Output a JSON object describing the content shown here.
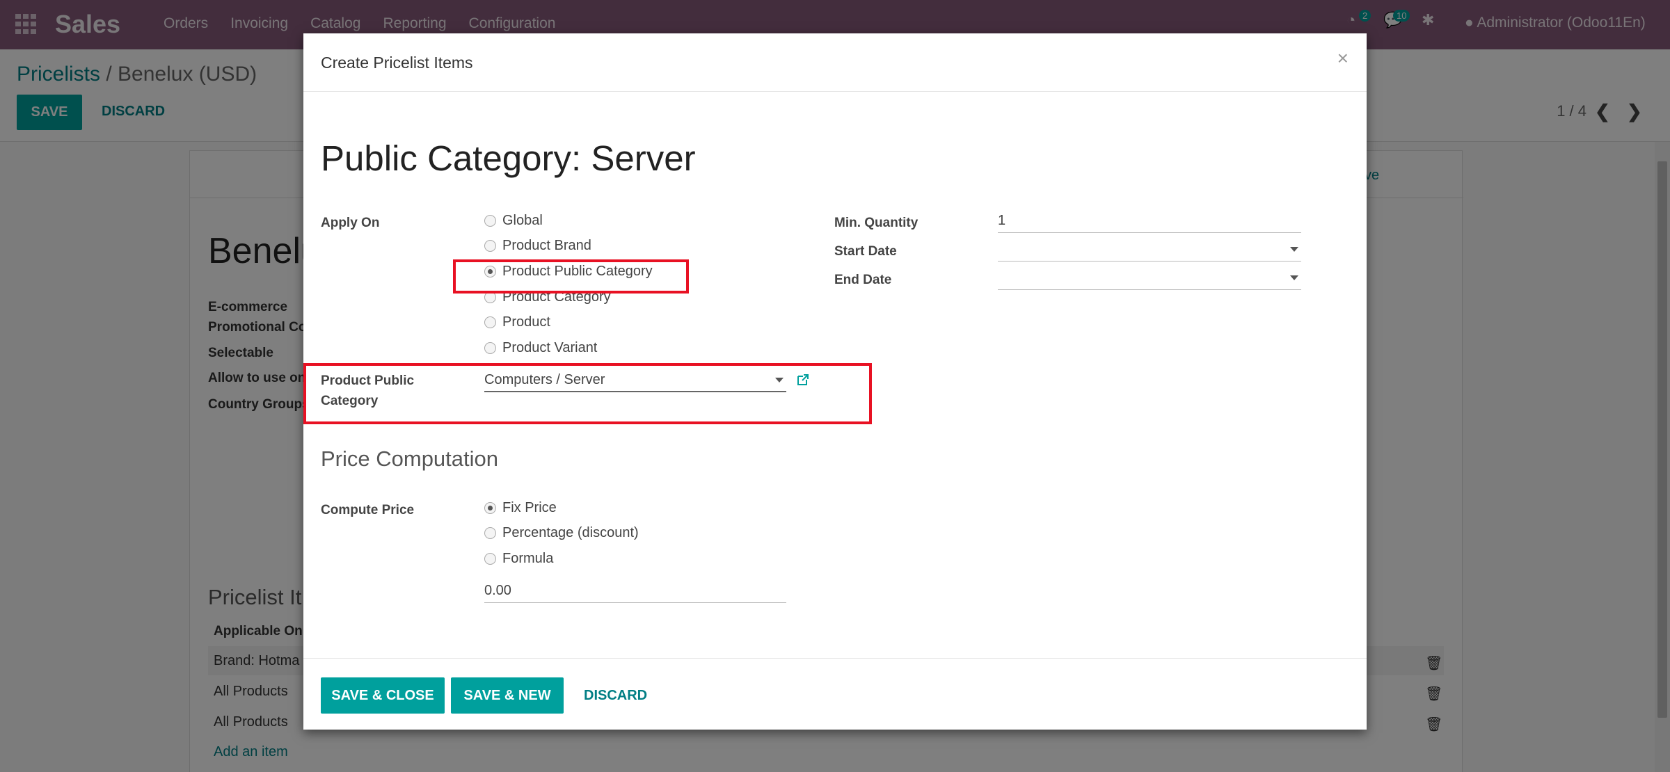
{
  "topbar": {
    "app_name": "Sales",
    "menu": [
      "Orders",
      "Invoicing",
      "Catalog",
      "Reporting",
      "Configuration"
    ],
    "activity_count": "2",
    "message_count": "10",
    "user": "Administrator (Odoo11En)"
  },
  "control": {
    "breadcrumb_root": "Pricelists",
    "breadcrumb_sep": "/",
    "breadcrumb_current": "Benelux (USD)",
    "save_label": "SAVE",
    "discard_label": "DISCARD",
    "pager": "1 / 4"
  },
  "background_form": {
    "name_partial": "Benelu",
    "active_partial": "ctive",
    "labels": [
      "E-commerce",
      "Promotional Co",
      "Selectable",
      "Allow to use on",
      "Country Groups"
    ],
    "section_partial": "Pricelist It",
    "col_header": "Applicable On",
    "rows": [
      "Brand: Hotma",
      "All Products",
      "All Products"
    ],
    "add_item": "Add an item"
  },
  "modal": {
    "title": "Create Pricelist Items",
    "close": "×",
    "record_title": "Public Category: Server",
    "apply_on_label": "Apply On",
    "apply_on_options": [
      "Global",
      "Product Brand",
      "Product Public Category",
      "Product Category",
      "Product",
      "Product Variant"
    ],
    "apply_on_selected": "Product Public Category",
    "min_quantity_label": "Min. Quantity",
    "min_quantity_value": "1",
    "start_date_label": "Start Date",
    "end_date_label": "End Date",
    "public_category_label_1": "Product Public",
    "public_category_label_2": "Category",
    "public_category_value": "Computers / Server",
    "price_section": "Price Computation",
    "compute_price_label": "Compute Price",
    "compute_options": [
      "Fix Price",
      "Percentage (discount)",
      "Formula"
    ],
    "compute_selected": "Fix Price",
    "fixed_price_value": "0.00",
    "save_close": "SAVE & CLOSE",
    "save_new": "SAVE & NEW",
    "discard": "DISCARD"
  },
  "colors": {
    "brand": "#875a7b",
    "accent": "#00a09d",
    "highlight": "#e81123"
  }
}
